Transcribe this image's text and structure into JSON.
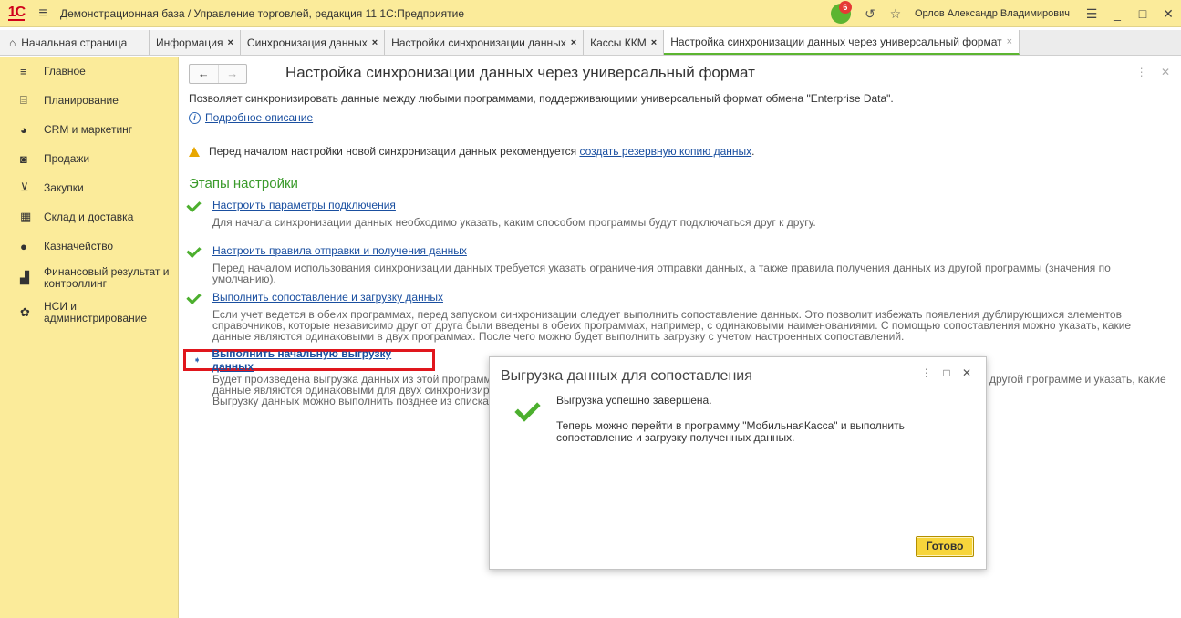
{
  "titlebar": {
    "logo": "1С",
    "app_title": "Демонстрационная база / Управление торговлей, редакция 11 1С:Предприятие",
    "notifications_count": "6",
    "user": "Орлов Александр Владимирович"
  },
  "tabs": [
    {
      "label": "Начальная страница"
    },
    {
      "label": "Информация",
      "close": "×"
    },
    {
      "label": "Синхронизация данных",
      "close": "×"
    },
    {
      "label": "Настройки синхронизации данных",
      "close": "×"
    },
    {
      "label": "Кассы ККМ",
      "close": "×"
    },
    {
      "label": "Настройка синхронизации данных через универсальный формат",
      "close": "×"
    }
  ],
  "sidebar": {
    "items": [
      {
        "label": "Главное",
        "icon": "menu-icon"
      },
      {
        "label": "Планирование",
        "icon": "planning-icon"
      },
      {
        "label": "CRM и маркетинг",
        "icon": "pie-chart-icon"
      },
      {
        "label": "Продажи",
        "icon": "shopping-bag-icon"
      },
      {
        "label": "Закупки",
        "icon": "cart-icon"
      },
      {
        "label": "Склад и доставка",
        "icon": "warehouse-icon"
      },
      {
        "label": "Казначейство",
        "icon": "money-icon"
      },
      {
        "label": "Финансовый результат и контроллинг",
        "icon": "bar-chart-icon"
      },
      {
        "label": "НСИ и администрирование",
        "icon": "gear-icon"
      }
    ]
  },
  "page": {
    "title": "Настройка синхронизации данных через универсальный формат",
    "description": "Позволяет синхронизировать данные между любыми программами, поддерживающими универсальный формат обмена \"Enterprise Data\".",
    "more_link": "Подробное описание",
    "warning_text": "Перед началом настройки новой синхронизации данных рекомендуется",
    "warning_link": "создать резервную копию данных",
    "warning_end": ".",
    "steps_title": "Этапы настройки",
    "steps": [
      {
        "title": "Настроить параметры подключения",
        "text": "Для начала синхронизации данных необходимо указать, каким способом программы будут подключаться друг к другу."
      },
      {
        "title": "Настроить правила отправки и получения данных",
        "text": "Перед началом использования синхронизации данных требуется указать ограничения отправки данных, а также правила получения данных из другой программы (значения по умолчанию)."
      },
      {
        "title": "Выполнить сопоставление и загрузку данных",
        "text": "Если учет ведется в обеих программах, перед запуском синхронизации следует выполнить сопоставление данных. Это позволит избежать появления дублирующихся элементов справочников, которые независимо друг от друга были введены в обеих программах, например, с одинаковыми наименованиями. С помощью сопоставления можно указать, какие данные являются одинаковыми в двух программах. После чего можно будет выполнить загрузку с учетом настроенных сопоставлений."
      }
    ],
    "current_step": {
      "title": "Выполнить начальную выгрузку данных",
      "line1": "Будет произведена выгрузка данных из этой программы",
      "line2": "данные являются одинаковыми для двух синхронизиру",
      "line3": "Выгрузку данных можно выполнить позднее из списка к",
      "line1_right": "другой программе и указать, какие"
    }
  },
  "dialog": {
    "title": "Выгрузка данных для сопоставления",
    "message1": "Выгрузка успешно завершена.",
    "message2": "Теперь можно перейти в программу \"МобильнаяКасса\" и выполнить сопоставление и загрузку полученных данных.",
    "ok_label": "Готово"
  }
}
